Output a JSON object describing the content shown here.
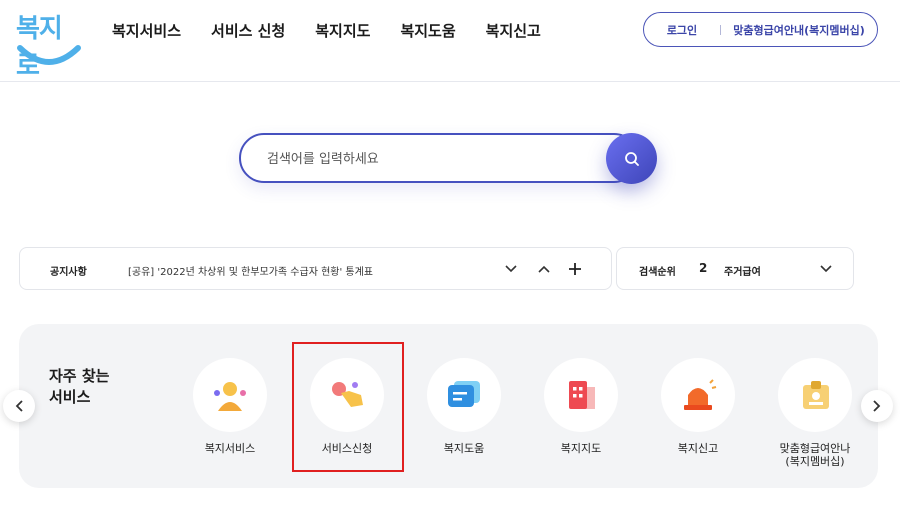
{
  "header": {
    "logo_text": "복지로",
    "nav": [
      "복지서비스",
      "서비스 신청",
      "복지지도",
      "복지도움",
      "복지신고"
    ],
    "login_label": "로그인",
    "member_label": "맞춤형급여안내(복지멤버십)"
  },
  "search": {
    "placeholder": "검색어를 입력하세요",
    "button_icon": "search-icon"
  },
  "notice": {
    "label": "공지사항",
    "text": "[공유] '2022년 차상위 및 한부모가족 수급자 현황' 통계표",
    "controls": [
      "chevron-down-icon",
      "chevron-up-icon",
      "plus-icon"
    ]
  },
  "rank": {
    "label": "검색순위",
    "number": "2",
    "keyword": "주거급여"
  },
  "quick": {
    "title_line1": "자주 찾는",
    "title_line2": "서비스",
    "items": [
      {
        "label": "복지서비스",
        "icon": "people-icon"
      },
      {
        "label": "서비스신청",
        "icon": "hand-tap-icon"
      },
      {
        "label": "복지도움",
        "icon": "chat-icon"
      },
      {
        "label": "복지지도",
        "icon": "building-icon"
      },
      {
        "label": "복지신고",
        "icon": "siren-icon"
      },
      {
        "label_line1": "맞춤형급여안나",
        "label_line2": "(복지멤버십)",
        "icon": "id-card-icon"
      }
    ]
  },
  "colors": {
    "brand": "#4651bf",
    "logo": "#4fb0e9",
    "highlight": "#e02020"
  }
}
